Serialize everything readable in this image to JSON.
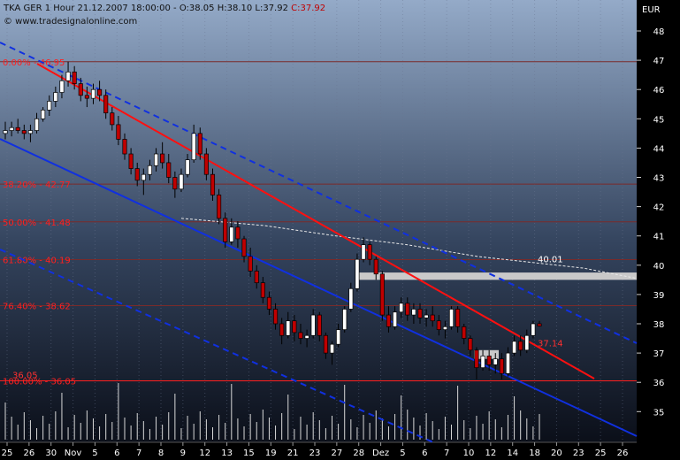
{
  "header": {
    "prefix": "TKA GER 1 Hour  21.12.2007 18:00:00 - O:38.05 H:38.10 L:37.92 ",
    "close": "C:37.92",
    "copyright": "© www.tradesignalonline.com"
  },
  "colors": {
    "bg_top": "#94aac8",
    "bg_bottom": "#0b0f19",
    "red_line": "#ff1010",
    "blue_line": "#1030e0",
    "fib_line": "#7a2a2a",
    "fib_text": "#ff2020",
    "dashed_ma": "#e8e8e8",
    "zone": "#c9c9c9"
  },
  "chart_data": {
    "type": "candlestick",
    "currency": "EUR",
    "ylim": [
      34,
      48.5
    ],
    "y_ticks": [
      35,
      36,
      37,
      38,
      39,
      40,
      41,
      42,
      43,
      44,
      45,
      46,
      47,
      48
    ],
    "x_ticks": [
      "25",
      "26",
      "30",
      "Nov",
      "5",
      "6",
      "7",
      "8",
      "9",
      "12",
      "13",
      "15",
      "19",
      "21",
      "23",
      "27",
      "28",
      "Dez",
      "5",
      "6",
      "7",
      "10",
      "12",
      "14",
      "18",
      "20",
      "23",
      "25",
      "26"
    ],
    "fib_levels": [
      {
        "label": "0.00% - 46.95",
        "value": 46.95
      },
      {
        "label": "38.20% - 42.77",
        "value": 42.77
      },
      {
        "label": "50.00% - 41.48",
        "value": 41.48
      },
      {
        "label": "61.80% - 40.19",
        "value": 40.19
      },
      {
        "label": "76.40% - 38.62",
        "value": 38.62
      },
      {
        "label": "100.00% - 36.05",
        "value": 36.05
      }
    ],
    "annotations": [
      {
        "text": "36.05",
        "value": 36.05
      },
      {
        "text": "40.01",
        "value": 40.01
      },
      {
        "text": "37.14",
        "value": 37.14
      }
    ],
    "candles": [
      {
        "o": 44.5,
        "h": 44.9,
        "l": 44.3,
        "c": 44.6
      },
      {
        "o": 44.6,
        "h": 44.9,
        "l": 44.4,
        "c": 44.7
      },
      {
        "o": 44.7,
        "h": 45.0,
        "l": 44.5,
        "c": 44.6
      },
      {
        "o": 44.6,
        "h": 44.8,
        "l": 44.3,
        "c": 44.5
      },
      {
        "o": 44.5,
        "h": 44.8,
        "l": 44.2,
        "c": 44.6
      },
      {
        "o": 44.6,
        "h": 45.2,
        "l": 44.5,
        "c": 45.0
      },
      {
        "o": 45.0,
        "h": 45.4,
        "l": 44.9,
        "c": 45.3
      },
      {
        "o": 45.3,
        "h": 45.8,
        "l": 45.1,
        "c": 45.6
      },
      {
        "o": 45.6,
        "h": 46.1,
        "l": 45.4,
        "c": 45.9
      },
      {
        "o": 45.9,
        "h": 46.5,
        "l": 45.7,
        "c": 46.3
      },
      {
        "o": 46.3,
        "h": 46.95,
        "l": 46.1,
        "c": 46.6
      },
      {
        "o": 46.6,
        "h": 46.8,
        "l": 46.0,
        "c": 46.2
      },
      {
        "o": 46.2,
        "h": 46.4,
        "l": 45.6,
        "c": 45.8
      },
      {
        "o": 45.8,
        "h": 46.1,
        "l": 45.4,
        "c": 45.7
      },
      {
        "o": 45.7,
        "h": 46.2,
        "l": 45.5,
        "c": 46.0
      },
      {
        "o": 46.0,
        "h": 46.3,
        "l": 45.6,
        "c": 45.8
      },
      {
        "o": 45.8,
        "h": 46.0,
        "l": 45.0,
        "c": 45.2
      },
      {
        "o": 45.2,
        "h": 45.4,
        "l": 44.6,
        "c": 44.8
      },
      {
        "o": 44.8,
        "h": 45.1,
        "l": 44.1,
        "c": 44.3
      },
      {
        "o": 44.3,
        "h": 44.5,
        "l": 43.6,
        "c": 43.8
      },
      {
        "o": 43.8,
        "h": 44.0,
        "l": 43.1,
        "c": 43.3
      },
      {
        "o": 43.3,
        "h": 43.5,
        "l": 42.7,
        "c": 42.9
      },
      {
        "o": 42.9,
        "h": 43.3,
        "l": 42.4,
        "c": 43.1
      },
      {
        "o": 43.1,
        "h": 43.6,
        "l": 42.9,
        "c": 43.4
      },
      {
        "o": 43.4,
        "h": 44.0,
        "l": 43.2,
        "c": 43.8
      },
      {
        "o": 43.8,
        "h": 44.2,
        "l": 43.3,
        "c": 43.5
      },
      {
        "o": 43.5,
        "h": 43.8,
        "l": 42.8,
        "c": 43.0
      },
      {
        "o": 43.0,
        "h": 43.2,
        "l": 42.3,
        "c": 42.6
      },
      {
        "o": 42.6,
        "h": 43.3,
        "l": 42.5,
        "c": 43.1
      },
      {
        "o": 43.1,
        "h": 43.8,
        "l": 43.0,
        "c": 43.6
      },
      {
        "o": 43.6,
        "h": 44.8,
        "l": 43.5,
        "c": 44.5
      },
      {
        "o": 44.5,
        "h": 44.7,
        "l": 43.6,
        "c": 43.8
      },
      {
        "o": 43.8,
        "h": 44.0,
        "l": 42.9,
        "c": 43.1
      },
      {
        "o": 43.1,
        "h": 43.3,
        "l": 42.2,
        "c": 42.4
      },
      {
        "o": 42.4,
        "h": 42.6,
        "l": 41.4,
        "c": 41.6
      },
      {
        "o": 41.6,
        "h": 41.8,
        "l": 40.6,
        "c": 40.8
      },
      {
        "o": 40.8,
        "h": 41.6,
        "l": 40.7,
        "c": 41.3
      },
      {
        "o": 41.3,
        "h": 41.5,
        "l": 40.6,
        "c": 40.9
      },
      {
        "o": 40.9,
        "h": 41.0,
        "l": 40.1,
        "c": 40.3
      },
      {
        "o": 40.3,
        "h": 40.6,
        "l": 39.6,
        "c": 39.8
      },
      {
        "o": 39.8,
        "h": 40.0,
        "l": 39.2,
        "c": 39.4
      },
      {
        "o": 39.4,
        "h": 39.6,
        "l": 38.7,
        "c": 38.9
      },
      {
        "o": 38.9,
        "h": 39.1,
        "l": 38.3,
        "c": 38.5
      },
      {
        "o": 38.5,
        "h": 38.7,
        "l": 37.8,
        "c": 38.0
      },
      {
        "o": 38.0,
        "h": 38.2,
        "l": 37.3,
        "c": 37.6
      },
      {
        "o": 37.6,
        "h": 38.4,
        "l": 37.5,
        "c": 38.1
      },
      {
        "o": 38.1,
        "h": 38.3,
        "l": 37.4,
        "c": 37.7
      },
      {
        "o": 37.7,
        "h": 38.0,
        "l": 37.3,
        "c": 37.5
      },
      {
        "o": 37.5,
        "h": 37.8,
        "l": 37.2,
        "c": 37.6
      },
      {
        "o": 37.6,
        "h": 38.5,
        "l": 37.5,
        "c": 38.3
      },
      {
        "o": 38.3,
        "h": 38.4,
        "l": 37.4,
        "c": 37.6
      },
      {
        "o": 37.6,
        "h": 37.7,
        "l": 36.8,
        "c": 37.0
      },
      {
        "o": 37.0,
        "h": 37.4,
        "l": 36.6,
        "c": 37.3
      },
      {
        "o": 37.3,
        "h": 38.0,
        "l": 37.2,
        "c": 37.8
      },
      {
        "o": 37.8,
        "h": 38.6,
        "l": 37.7,
        "c": 38.5
      },
      {
        "o": 38.5,
        "h": 39.4,
        "l": 38.4,
        "c": 39.2
      },
      {
        "o": 39.2,
        "h": 40.4,
        "l": 39.1,
        "c": 40.2
      },
      {
        "o": 40.2,
        "h": 40.95,
        "l": 40.1,
        "c": 40.7
      },
      {
        "o": 40.7,
        "h": 40.8,
        "l": 40.0,
        "c": 40.2
      },
      {
        "o": 40.2,
        "h": 40.3,
        "l": 39.5,
        "c": 39.7
      },
      {
        "o": 39.7,
        "h": 39.8,
        "l": 38.1,
        "c": 38.3
      },
      {
        "o": 38.3,
        "h": 38.6,
        "l": 37.7,
        "c": 37.9
      },
      {
        "o": 37.9,
        "h": 38.6,
        "l": 37.8,
        "c": 38.4
      },
      {
        "o": 38.4,
        "h": 38.9,
        "l": 38.2,
        "c": 38.7
      },
      {
        "o": 38.7,
        "h": 38.9,
        "l": 38.1,
        "c": 38.3
      },
      {
        "o": 38.3,
        "h": 38.7,
        "l": 38.0,
        "c": 38.5
      },
      {
        "o": 38.5,
        "h": 38.7,
        "l": 38.0,
        "c": 38.2
      },
      {
        "o": 38.2,
        "h": 38.5,
        "l": 37.9,
        "c": 38.3
      },
      {
        "o": 38.3,
        "h": 38.6,
        "l": 37.9,
        "c": 38.1
      },
      {
        "o": 38.1,
        "h": 38.3,
        "l": 37.6,
        "c": 37.8
      },
      {
        "o": 37.8,
        "h": 38.1,
        "l": 37.5,
        "c": 37.9
      },
      {
        "o": 37.9,
        "h": 38.6,
        "l": 37.8,
        "c": 38.5
      },
      {
        "o": 38.5,
        "h": 38.6,
        "l": 37.7,
        "c": 37.9
      },
      {
        "o": 37.9,
        "h": 38.0,
        "l": 37.3,
        "c": 37.5
      },
      {
        "o": 37.5,
        "h": 37.6,
        "l": 36.9,
        "c": 37.1
      },
      {
        "o": 37.1,
        "h": 37.2,
        "l": 36.1,
        "c": 36.5
      },
      {
        "o": 36.5,
        "h": 37.1,
        "l": 36.4,
        "c": 36.9
      },
      {
        "o": 36.9,
        "h": 37.1,
        "l": 36.4,
        "c": 36.6
      },
      {
        "o": 36.6,
        "h": 37.0,
        "l": 36.3,
        "c": 36.8
      },
      {
        "o": 36.8,
        "h": 37.0,
        "l": 36.1,
        "c": 36.3
      },
      {
        "o": 36.3,
        "h": 37.2,
        "l": 36.2,
        "c": 37.0
      },
      {
        "o": 37.0,
        "h": 37.6,
        "l": 36.9,
        "c": 37.4
      },
      {
        "o": 37.4,
        "h": 37.6,
        "l": 36.9,
        "c": 37.1
      },
      {
        "o": 37.1,
        "h": 37.8,
        "l": 37.0,
        "c": 37.6
      },
      {
        "o": 37.6,
        "h": 38.1,
        "l": 37.5,
        "c": 38.0
      },
      {
        "o": 38.0,
        "h": 38.1,
        "l": 37.9,
        "c": 37.92
      }
    ]
  }
}
